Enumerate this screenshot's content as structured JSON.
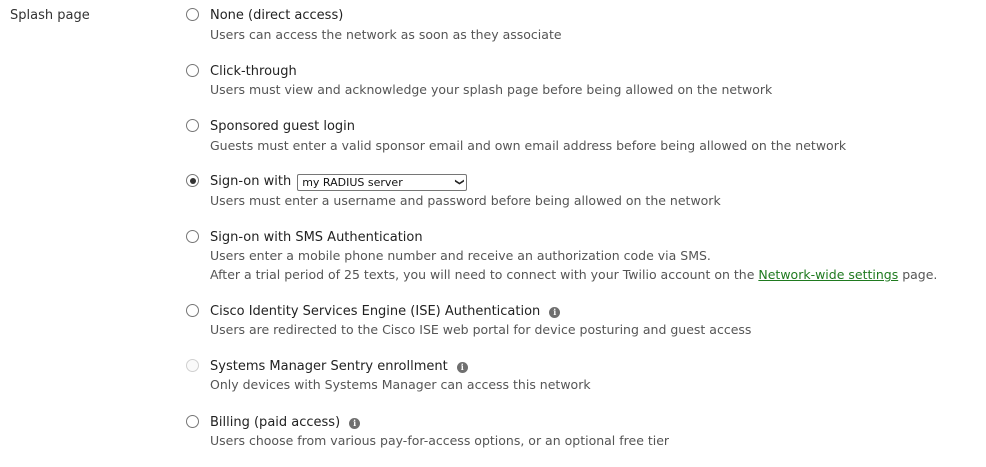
{
  "section_label": "Splash page",
  "options": [
    {
      "title": "None (direct access)",
      "description": "Users can access the network as soon as they associate",
      "checked": false,
      "disabled": false,
      "info": false
    },
    {
      "title": "Click-through",
      "description": "Users must view and acknowledge your splash page before being allowed on the network",
      "checked": false,
      "disabled": false,
      "info": false
    },
    {
      "title": "Sponsored guest login",
      "description": "Guests must enter a valid sponsor email and own email address before being allowed on the network",
      "checked": false,
      "disabled": false,
      "info": false
    },
    {
      "title": "Sign-on with",
      "description": "Users must enter a username and password before being allowed on the network",
      "checked": true,
      "disabled": false,
      "info": false,
      "select_value": "my RADIUS server"
    },
    {
      "title": "Sign-on with SMS Authentication",
      "description": "Users enter a mobile phone number and receive an authorization code via SMS.",
      "description2_prefix": "After a trial period of 25 texts, you will need to connect with your Twilio account on the ",
      "description2_link": "Network-wide settings",
      "description2_suffix": " page.",
      "checked": false,
      "disabled": false,
      "info": false
    },
    {
      "title": "Cisco Identity Services Engine (ISE) Authentication",
      "description": "Users are redirected to the Cisco ISE web portal for device posturing and guest access",
      "checked": false,
      "disabled": false,
      "info": true
    },
    {
      "title": "Systems Manager Sentry enrollment",
      "description": "Only devices with Systems Manager can access this network",
      "checked": false,
      "disabled": true,
      "info": true
    },
    {
      "title": "Billing (paid access)",
      "description": "Users choose from various pay-for-access options, or an optional free tier",
      "checked": false,
      "disabled": false,
      "info": true
    }
  ],
  "info_glyph": "i",
  "select_chevron": "❯",
  "colors": {
    "link": "#1f7a1f",
    "text": "#333333",
    "muted": "#555555"
  }
}
